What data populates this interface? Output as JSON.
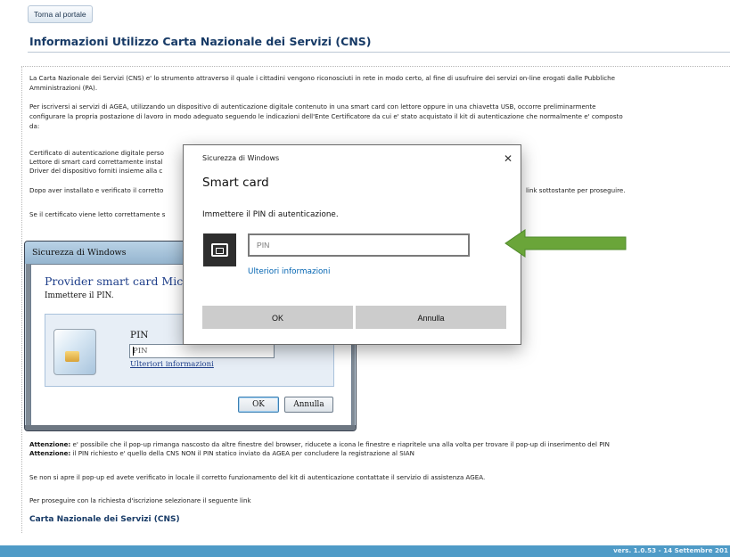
{
  "portal_button": "Torna al portale",
  "page_title": "Informazioni Utilizzo Carta Nazionale dei Servizi (CNS)",
  "intro": {
    "p1_line1": "La Carta Nazionale dei Servizi (CNS) e' lo strumento attraverso il quale i cittadini vengono riconosciuti in rete in modo certo, al fine di usufruire dei servizi on-line erogati dalle Pubbliche",
    "p1_line2": "Amministrazioni (PA).",
    "p2_line1": "Per iscriversi ai servizi di AGEA, utilizzando un dispositivo di autenticazione digitale contenuto in una smart card con lettore oppure in una chiavetta USB, occorre preliminarmente",
    "p2_line2": "configurare la propria postazione di lavoro in modo adeguato seguendo le indicazioni dell'Ente Certificatore da cui e' stato acquistato il kit di autenticazione che normalmente e' composto",
    "p2_line3": "da:",
    "list_1": "Certificato di autenticazione digitale perso",
    "list_2": "Lettore di smart card correttamente instal",
    "list_3": "Driver del dispositivo forniti insieme alla c",
    "p3_left": "Dopo aver installato e verificato il corretto",
    "p3_right": "link sottostante per proseguire.",
    "p4_left": "Se il certificato viene letto correttamente s"
  },
  "warnings": {
    "w1_label": "Attenzione:",
    "w1_text": "e' possibile che il pop-up rimanga nascosto da altre finestre del browser, riducete a icona le finestre e riapritele una alla volta per trovare il pop-up di inserimento del PIN",
    "w2_label": "Attenzione:",
    "w2_text": "il PIN richiesto e' quello della CNS NON il PIN statico inviato da AGEA per concludere la registrazione al SIAN",
    "support": "Se non si apre il pop-up ed avete verificato in locale il corretto funzionamento del kit di autenticazione contattate il servizio di assistenza AGEA.",
    "proceed": "Per proseguire con la richiesta d'iscrizione selezionare il seguente link"
  },
  "cns_link": "Carta Nazionale dei Servizi (CNS)",
  "footer_version": "vers. 1.0.53 - 14 Settembre 201",
  "win7_dialog": {
    "title": "Sicurezza di Windows",
    "heading": "Provider smart card Micros",
    "instruction": "Immettere il PIN.",
    "pin_label": "PIN",
    "pin_placeholder": "PIN",
    "more_info": "Ulteriori informazioni",
    "ok": "OK",
    "cancel": "Annulla",
    "icon": "smart-card-chip"
  },
  "win10_dialog": {
    "caption": "Sicurezza di Windows",
    "close_glyph": "✕",
    "heading": "Smart card",
    "instruction": "Immettere il PIN di autenticazione.",
    "pin_placeholder": "PIN",
    "more_info": "Ulteriori informazioni",
    "ok": "OK",
    "cancel": "Annulla",
    "icon": "smart-card-tile"
  },
  "colors": {
    "title": "#173a66",
    "footer_bar": "#4f9bc7",
    "win10_link": "#0063b1",
    "arrow_green": "#6aa539"
  }
}
